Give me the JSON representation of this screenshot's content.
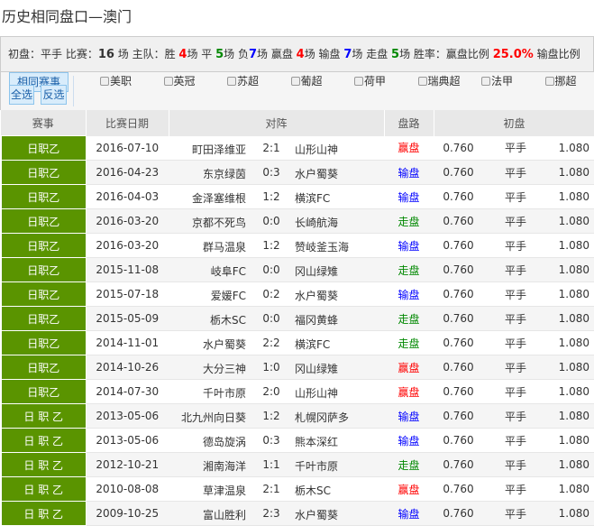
{
  "title": "历史相同盘口—澳门",
  "stats": {
    "l1": "初盘：",
    "handicap": "平手",
    "l2": " 比赛：",
    "matches": "16",
    "l3": " 场  主队：胜 ",
    "win": "4",
    "l4": "场 平 ",
    "draw": "5",
    "l5": "场 负",
    "loss": "7",
    "l6": "场   赢盘 ",
    "winpan": "4",
    "l7": "场 输盘 ",
    "losspan": "7",
    "l8": "场 走盘 ",
    "drawpan": "5",
    "l9": "场  胜率：赢盘比例 ",
    "winrate": "25.0%",
    "l10": "  输盘比例"
  },
  "buttons": {
    "same": "相同赛事",
    "all": "全选",
    "invert": "反选"
  },
  "leagues": [
    "美职",
    "英冠",
    "苏超",
    "葡超",
    "荷甲",
    "瑞典超",
    "法甲",
    "挪超"
  ],
  "headers": [
    "赛事",
    "比赛日期",
    "对阵",
    "盘路",
    "初盘"
  ],
  "colors": {
    "league_bg": "#5a9400",
    "win": "#ff0000",
    "loss": "#0000ff",
    "draw": "#008800"
  },
  "rows": [
    {
      "league": "日职乙",
      "date": "2016-07-10",
      "home": "町田泽维亚",
      "score": "2:1",
      "away": "山形山神",
      "result": "赢盘",
      "o1": "0.760",
      "h": "平手",
      "o2": "1.080"
    },
    {
      "league": "日职乙",
      "date": "2016-04-23",
      "home": "东京绿茵",
      "score": "0:3",
      "away": "水户蜀葵",
      "result": "输盘",
      "o1": "0.760",
      "h": "平手",
      "o2": "1.080"
    },
    {
      "league": "日职乙",
      "date": "2016-04-03",
      "home": "金泽塞维根",
      "score": "1:2",
      "away": "横滨FC",
      "result": "输盘",
      "o1": "0.760",
      "h": "平手",
      "o2": "1.080"
    },
    {
      "league": "日职乙",
      "date": "2016-03-20",
      "home": "京都不死鸟",
      "score": "0:0",
      "away": "长崎航海",
      "result": "走盘",
      "o1": "0.760",
      "h": "平手",
      "o2": "1.080"
    },
    {
      "league": "日职乙",
      "date": "2016-03-20",
      "home": "群马温泉",
      "score": "1:2",
      "away": "赞岐釜玉海",
      "result": "输盘",
      "o1": "0.760",
      "h": "平手",
      "o2": "1.080"
    },
    {
      "league": "日职乙",
      "date": "2015-11-08",
      "home": "岐阜FC",
      "score": "0:0",
      "away": "冈山绿雉",
      "result": "走盘",
      "o1": "0.760",
      "h": "平手",
      "o2": "1.080"
    },
    {
      "league": "日职乙",
      "date": "2015-07-18",
      "home": "爱媛FC",
      "score": "0:2",
      "away": "水户蜀葵",
      "result": "输盘",
      "o1": "0.760",
      "h": "平手",
      "o2": "1.080"
    },
    {
      "league": "日职乙",
      "date": "2015-05-09",
      "home": "栃木SC",
      "score": "0:0",
      "away": "福冈黄蜂",
      "result": "走盘",
      "o1": "0.760",
      "h": "平手",
      "o2": "1.080"
    },
    {
      "league": "日职乙",
      "date": "2014-11-01",
      "home": "水户蜀葵",
      "score": "2:2",
      "away": "横滨FC",
      "result": "走盘",
      "o1": "0.760",
      "h": "平手",
      "o2": "1.080"
    },
    {
      "league": "日职乙",
      "date": "2014-10-26",
      "home": "大分三神",
      "score": "1:0",
      "away": "冈山绿雉",
      "result": "赢盘",
      "o1": "0.760",
      "h": "平手",
      "o2": "1.080"
    },
    {
      "league": "日职乙",
      "date": "2014-07-30",
      "home": "千叶市原",
      "score": "2:0",
      "away": "山形山神",
      "result": "赢盘",
      "o1": "0.760",
      "h": "平手",
      "o2": "1.080"
    },
    {
      "league": "日 职 乙",
      "date": "2013-05-06",
      "home": "北九州向日葵",
      "score": "1:2",
      "away": "札幌冈萨多",
      "result": "输盘",
      "o1": "0.760",
      "h": "平手",
      "o2": "1.080"
    },
    {
      "league": "日 职 乙",
      "date": "2013-05-06",
      "home": "德岛旋涡",
      "score": "0:3",
      "away": "熊本深红",
      "result": "输盘",
      "o1": "0.760",
      "h": "平手",
      "o2": "1.080"
    },
    {
      "league": "日 职 乙",
      "date": "2012-10-21",
      "home": "湘南海洋",
      "score": "1:1",
      "away": "千叶市原",
      "result": "走盘",
      "o1": "0.760",
      "h": "平手",
      "o2": "1.080"
    },
    {
      "league": "日 职 乙",
      "date": "2010-08-08",
      "home": "草津温泉",
      "score": "2:1",
      "away": "栃木SC",
      "result": "赢盘",
      "o1": "0.760",
      "h": "平手",
      "o2": "1.080"
    },
    {
      "league": "日 职 乙",
      "date": "2009-10-25",
      "home": "富山胜利",
      "score": "2:3",
      "away": "水户蜀葵",
      "result": "输盘",
      "o1": "0.760",
      "h": "平手",
      "o2": "1.080"
    }
  ]
}
